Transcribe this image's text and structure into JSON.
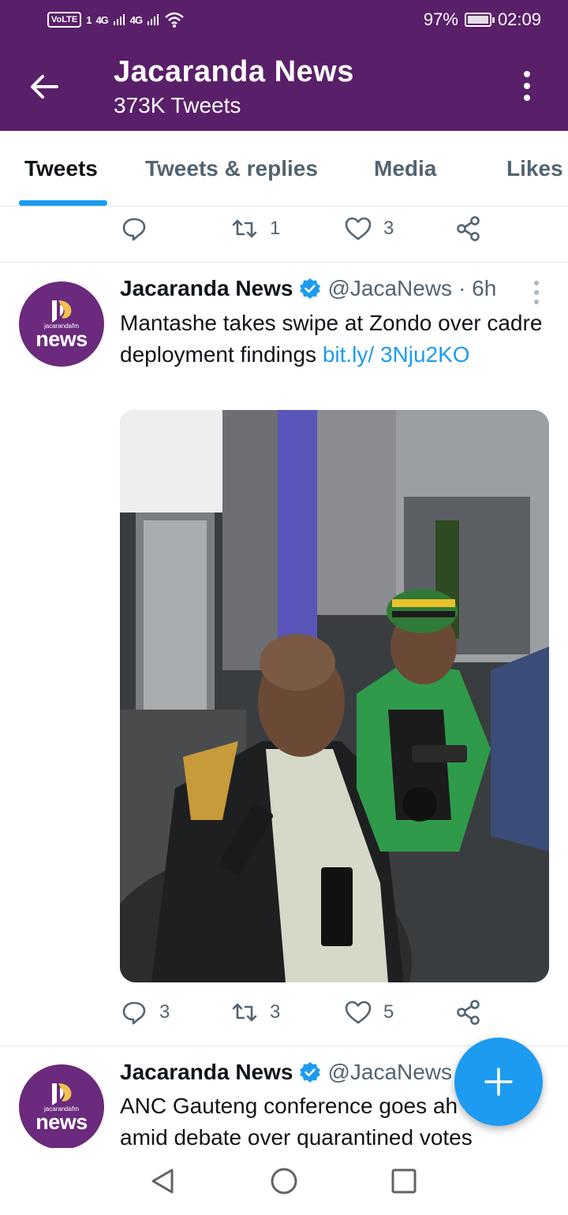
{
  "status_bar": {
    "volte": "VoLTE",
    "sim1": "1",
    "signal1": "4G",
    "signal2": "4G",
    "battery": "97%",
    "time": "02:09"
  },
  "header": {
    "title": "Jacaranda News",
    "subtitle": "373K Tweets"
  },
  "tabs": [
    "Tweets",
    "Tweets & replies",
    "Media",
    "Likes"
  ],
  "prev_tweet_actions": {
    "reply": "",
    "retweet": "1",
    "like": "3"
  },
  "tweets": [
    {
      "avatar_small": "jacarandafm",
      "avatar_big": "news",
      "name": "Jacaranda News",
      "handle": "@JacaNews",
      "time": "· 6h",
      "text": "Mantashe takes swipe at Zondo over cadre deployment findings ",
      "link": "bit.ly/ 3Nju2KO",
      "actions": {
        "reply": "3",
        "retweet": "3",
        "like": "5"
      }
    },
    {
      "avatar_small": "jacarandafm",
      "avatar_big": "news",
      "name": "Jacaranda News",
      "handle": "@JacaNews",
      "text": "ANC Gauteng conference goes ah amid debate over quarantined votes"
    }
  ],
  "colors": {
    "header_bg": "#5a1f69",
    "accent": "#1d9bf0",
    "muted": "#536471"
  }
}
